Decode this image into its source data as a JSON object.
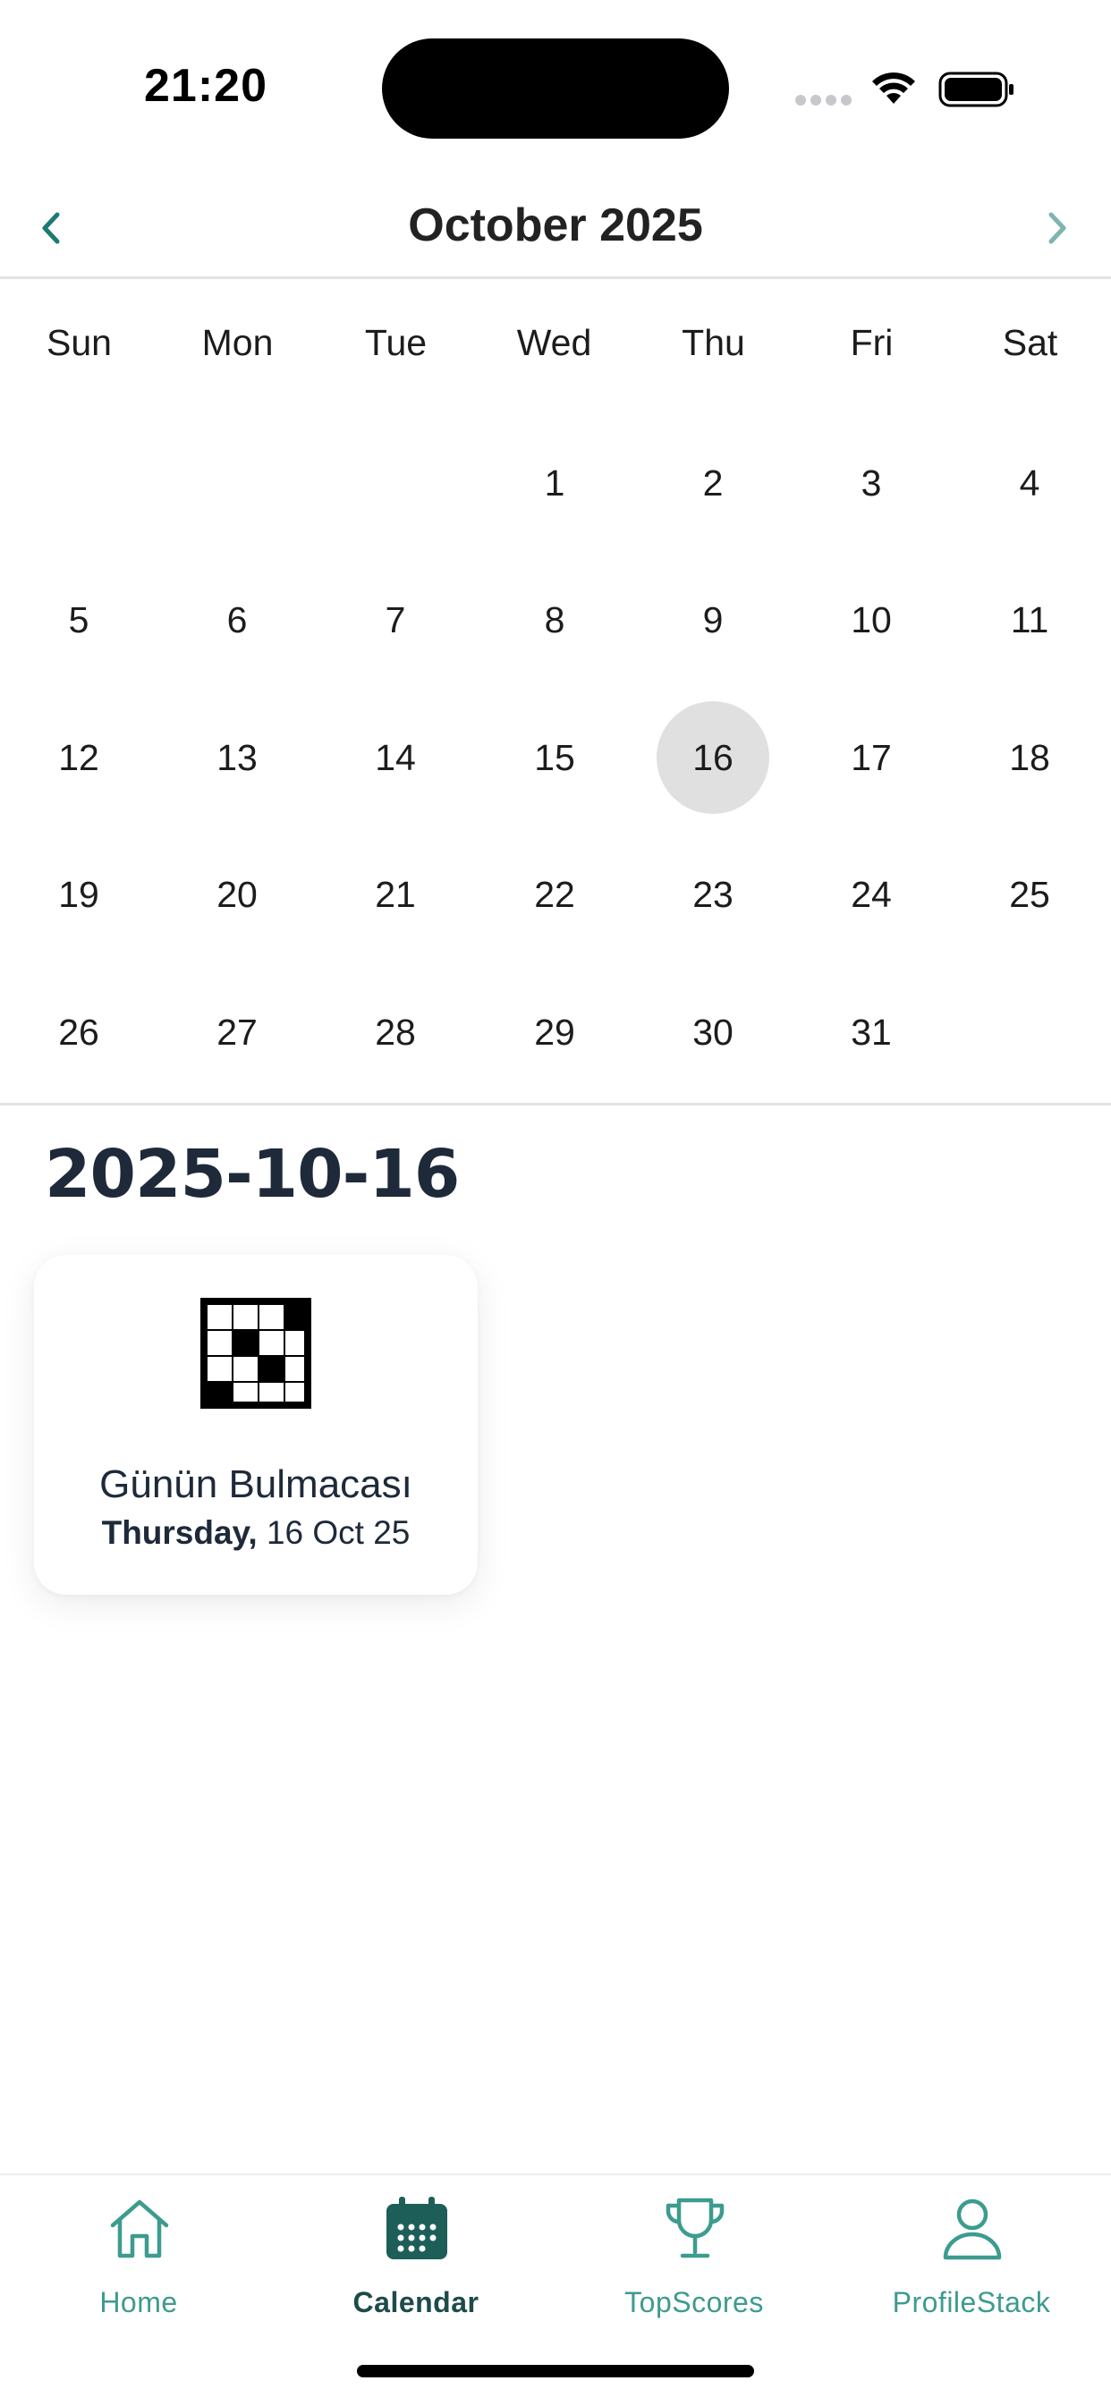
{
  "status_bar": {
    "time": "21:20"
  },
  "calendar": {
    "month_title": "October 2025",
    "weekdays": [
      "Sun",
      "Mon",
      "Tue",
      "Wed",
      "Thu",
      "Fri",
      "Sat"
    ],
    "weeks": [
      [
        "",
        "",
        "",
        "1",
        "2",
        "3",
        "4"
      ],
      [
        "5",
        "6",
        "7",
        "8",
        "9",
        "10",
        "11"
      ],
      [
        "12",
        "13",
        "14",
        "15",
        "16",
        "17",
        "18"
      ],
      [
        "19",
        "20",
        "21",
        "22",
        "23",
        "24",
        "25"
      ],
      [
        "26",
        "27",
        "28",
        "29",
        "30",
        "31",
        ""
      ]
    ],
    "selected_day": "16"
  },
  "selection": {
    "date_heading": "2025-10-16",
    "puzzle": {
      "title": "Günün Bulmacası",
      "weekday": "Thursday,",
      "date": "16 Oct 25"
    }
  },
  "tabs": [
    {
      "label": "Home",
      "icon": "home-icon",
      "active": false
    },
    {
      "label": "Calendar",
      "icon": "calendar-icon",
      "active": true
    },
    {
      "label": "TopScores",
      "icon": "trophy-icon",
      "active": false
    },
    {
      "label": "ProfileStack",
      "icon": "profile-icon",
      "active": false
    }
  ],
  "colors": {
    "accent": "#3d9b8f",
    "active_tab": "#1e4a4a",
    "selected_day_bg": "#e0e0e0",
    "heading": "#1e2a3a"
  }
}
